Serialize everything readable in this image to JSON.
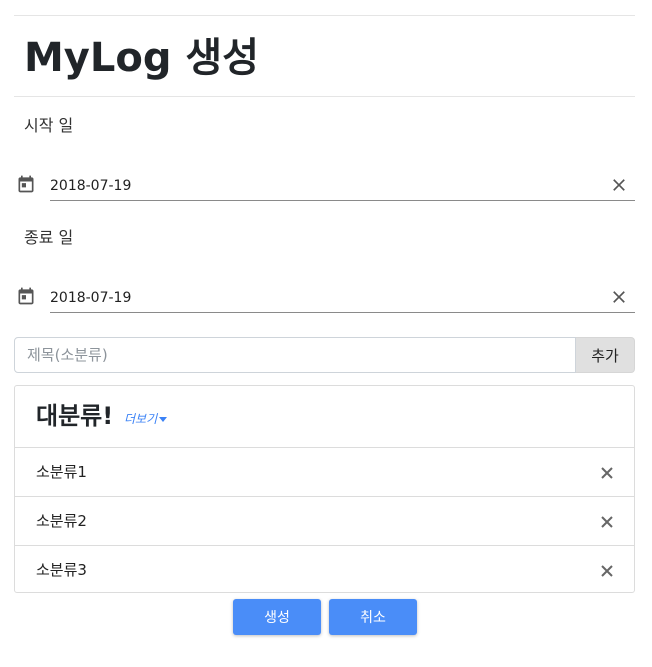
{
  "page": {
    "title": "MyLog 생성"
  },
  "start_date": {
    "label": "시작 일",
    "value": "2018-07-19",
    "icon": "calendar-icon",
    "clear_icon": "close-icon"
  },
  "end_date": {
    "label": "종료 일",
    "value": "2018-07-19",
    "icon": "calendar-icon",
    "clear_icon": "close-icon"
  },
  "add_subcategory": {
    "placeholder": "제목(소분류)",
    "value": "",
    "button_label": "추가"
  },
  "category_card": {
    "title": "대분류!",
    "more_label": "더보기",
    "items": [
      {
        "label": "소분류1"
      },
      {
        "label": "소분류2"
      },
      {
        "label": "소분류3"
      }
    ]
  },
  "actions": {
    "create_label": "생성",
    "cancel_label": "취소"
  },
  "colors": {
    "primary": "#4a8df8",
    "link": "#3b82f6",
    "add_button_bg": "#e0e0e0"
  }
}
